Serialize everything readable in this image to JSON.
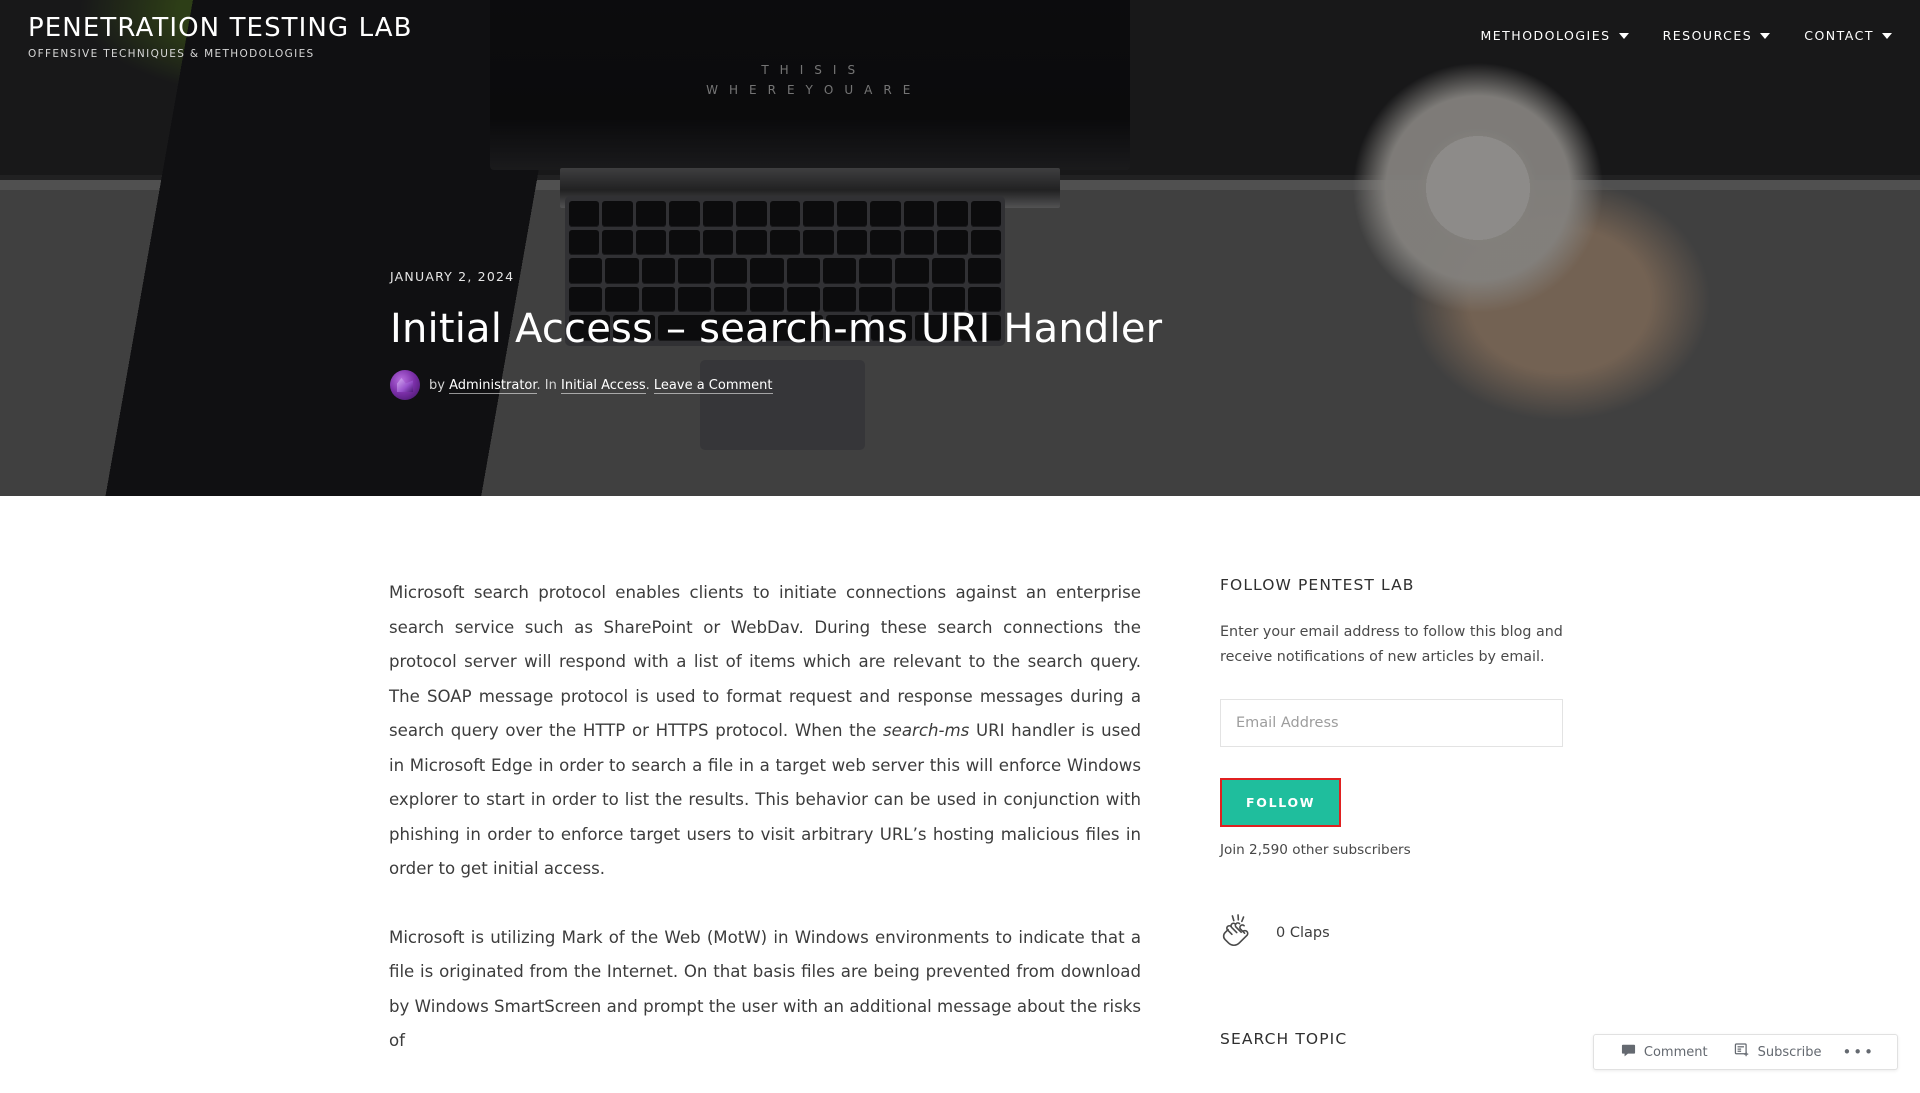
{
  "site": {
    "title": "PENETRATION TESTING LAB",
    "tagline": "OFFENSIVE TECHNIQUES & METHODOLOGIES"
  },
  "nav": {
    "items": [
      {
        "label": "METHODOLOGIES",
        "icon": "chevron-down-icon",
        "has_caret": true
      },
      {
        "label": "RESOURCES",
        "icon": "chevron-down-icon",
        "has_caret": true
      },
      {
        "label": "CONTACT",
        "icon": "chevron-down-icon",
        "has_caret": true
      }
    ]
  },
  "hero": {
    "screen_line1": "T H I S   I S",
    "screen_line2": "W H E R E   Y O U   A R E",
    "overlay_color": "#000000"
  },
  "post": {
    "date": "JANUARY 2, 2024",
    "title": "Initial Access – search-ms URI Handler",
    "byline_prefix": "by",
    "author": "Administrator",
    "byline_middle": ". In",
    "category": "Initial Access",
    "byline_sep": ".",
    "comment_link": "Leave a Comment",
    "avatar_icon": "user-avatar"
  },
  "article": {
    "paragraph1_part1": "Microsoft search protocol enables clients to initiate connections against an enterprise search service such as SharePoint or WebDav. During these search connections the protocol server will respond with a list of items which are relevant to the search query. The SOAP message protocol is used to format request and response messages during a search query over the HTTP or HTTPS protocol. When the ",
    "paragraph1_italic": "search-ms",
    "paragraph1_part2": " URI handler is used in Microsoft Edge in order to search a file in a target web server this will enforce Windows explorer to start in order to list the results. This behavior can be used in conjunction with phishing in order to enforce target users to visit arbitrary URL’s hosting malicious files in order to get initial access.",
    "paragraph2": "Microsoft is utilizing Mark of the Web (MotW) in Windows environments to indicate that a file is originated from the Internet. On that basis files are being prevented from download by Windows SmartScreen and prompt the user with an additional message about the risks of"
  },
  "sidebar": {
    "follow_widget": {
      "title": "FOLLOW PENTEST LAB",
      "description": "Enter your email address to follow this blog and receive notifications of new articles by email.",
      "email_placeholder": "Email Address",
      "email_value": "",
      "button_label": "FOLLOW",
      "button_color": "#1FBE9D",
      "button_focus_outline": "#E02020",
      "subscribers": "Join 2,590 other subscribers"
    },
    "claps": {
      "icon": "clapping-hands-icon",
      "label": "0 Claps"
    },
    "search_widget": {
      "title": "SEARCH TOPIC"
    }
  },
  "admin_bar": {
    "comment": {
      "label": "Comment",
      "icon": "comment-icon"
    },
    "subscribe": {
      "label": "Subscribe",
      "icon": "subscribe-form-icon"
    },
    "overflow": {
      "label": "•••",
      "icon": "ellipsis-icon"
    }
  }
}
